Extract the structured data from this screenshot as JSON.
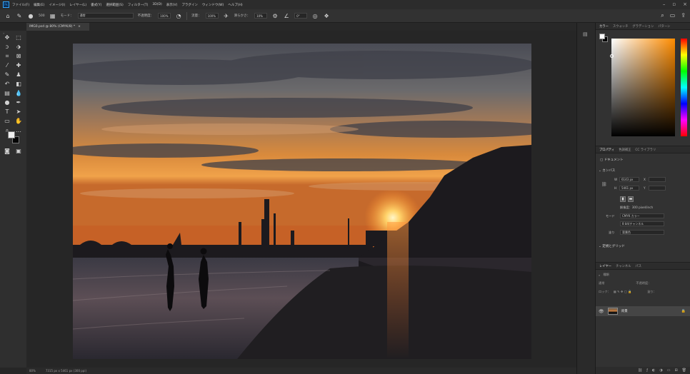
{
  "app": {
    "logo": "Ps",
    "menu": [
      "ファイル(F)",
      "編集(E)",
      "イメージ(I)",
      "レイヤー(L)",
      "書式(Y)",
      "選択範囲(S)",
      "フィルター(T)",
      "3D(D)",
      "表示(V)",
      "プラグイン",
      "ウィンドウ(W)",
      "ヘルプ(H)"
    ]
  },
  "options": {
    "brush_size": "500",
    "mode_label": "モード：",
    "mode_value": "通常",
    "opacity_label": "不透明度：",
    "opacity_value": "100%",
    "flow_label": "流量：",
    "flow_value": "100%",
    "smoothing_label": "滑らかさ：",
    "smoothing_value": "10%",
    "angle_value": "0°"
  },
  "document": {
    "tab_title": "IMG0.psd @ 80% (CMYK/8) *",
    "close_label": "×",
    "status_zoom": "80%",
    "status_info": "7315 px x 5461 px (300 ppi)"
  },
  "panels": {
    "color_tabs": [
      "カラー",
      "スウォッチ",
      "グラデーション",
      "パターン"
    ],
    "props_tabs": [
      "プロパティ",
      "色調補正",
      "CC ライブラリ"
    ],
    "doc_label": "ドキュメント",
    "canvas_heading": "カンバス",
    "width_label": "W",
    "width_value": "6143 px",
    "height_label": "H",
    "height_value": "5461 px",
    "x_label": "X",
    "y_label": "Y",
    "resolution": "解像度：300 pixel/inch",
    "mode_label": "モード",
    "mode_value": "CMYK カラー",
    "depth_value": "8 bit/チャンネル",
    "fill_label": "塗り",
    "fill_value": "背景色",
    "rulers_heading": "定規とグリッド",
    "layers_tabs": [
      "レイヤー",
      "チャンネル",
      "パス"
    ],
    "layers_search": "種類",
    "blend_mode": "通常",
    "opacity_label": "不透明度：",
    "lock_label": "ロック：",
    "fill_short": "塗り：",
    "layer_name": "背景"
  },
  "colors": {
    "accent": "#31a8ff",
    "panel_bg": "#323232",
    "canvas_bg": "#262626",
    "sun": "#ffd36a"
  },
  "icons": [
    "home-icon",
    "brush-icon",
    "search-icon",
    "move-icon",
    "eye-icon",
    "lock-icon",
    "link-icon"
  ]
}
